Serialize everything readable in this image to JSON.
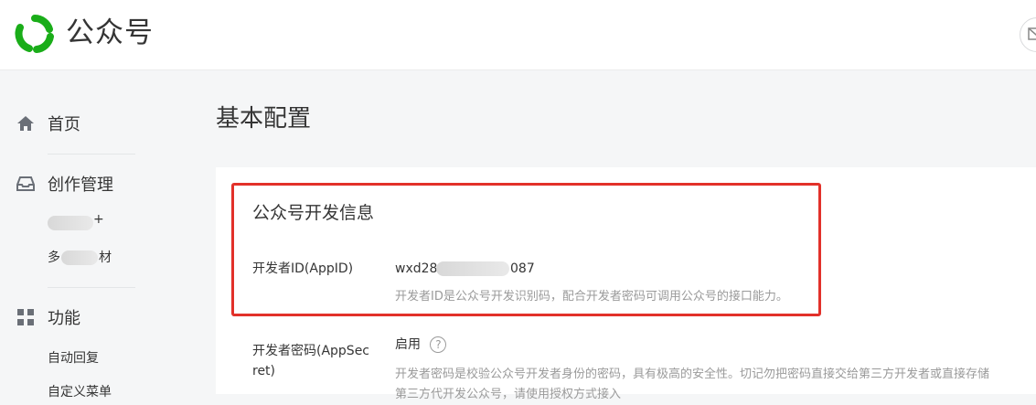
{
  "header": {
    "brand": "公众号",
    "logo_icon": "wechat-official-accounts-logo",
    "right_button_icon": "mail-icon"
  },
  "sidebar": {
    "home": {
      "label": "首页",
      "icon": "home-icon"
    },
    "creation": {
      "label": "创作管理",
      "icon": "inbox-icon",
      "items": [
        {
          "label": "+"
        },
        {
          "label_prefix": "多",
          "label_suffix": "材"
        }
      ]
    },
    "features": {
      "label": "功能",
      "icon": "grid-icon",
      "items": [
        {
          "label": "自动回复"
        },
        {
          "label": "自定义菜单"
        }
      ]
    }
  },
  "main": {
    "title": "基本配置",
    "dev_info": {
      "title": "公众号开发信息",
      "appid": {
        "label": "开发者ID(AppID)",
        "value_prefix": "wxd28",
        "value_suffix": "087",
        "desc": "开发者ID是公众号开发识别码，配合开发者密码可调用公众号的接口能力。"
      },
      "appsecret": {
        "label_line1": "开发者密码(AppSec",
        "label_line2": "ret)",
        "status": "启用",
        "help": "?",
        "desc_line1": "开发者密码是校验公众号开发者身份的密码，具有极高的安全性。切记勿把密码直接交给第三方开发者或直接存储",
        "desc_line2": "第三方代开发公众号，请使用授权方式接入"
      }
    }
  },
  "colors": {
    "brand_green": "#1aad19",
    "highlight_red": "#e2312a",
    "muted_text": "#9a9a9a"
  }
}
